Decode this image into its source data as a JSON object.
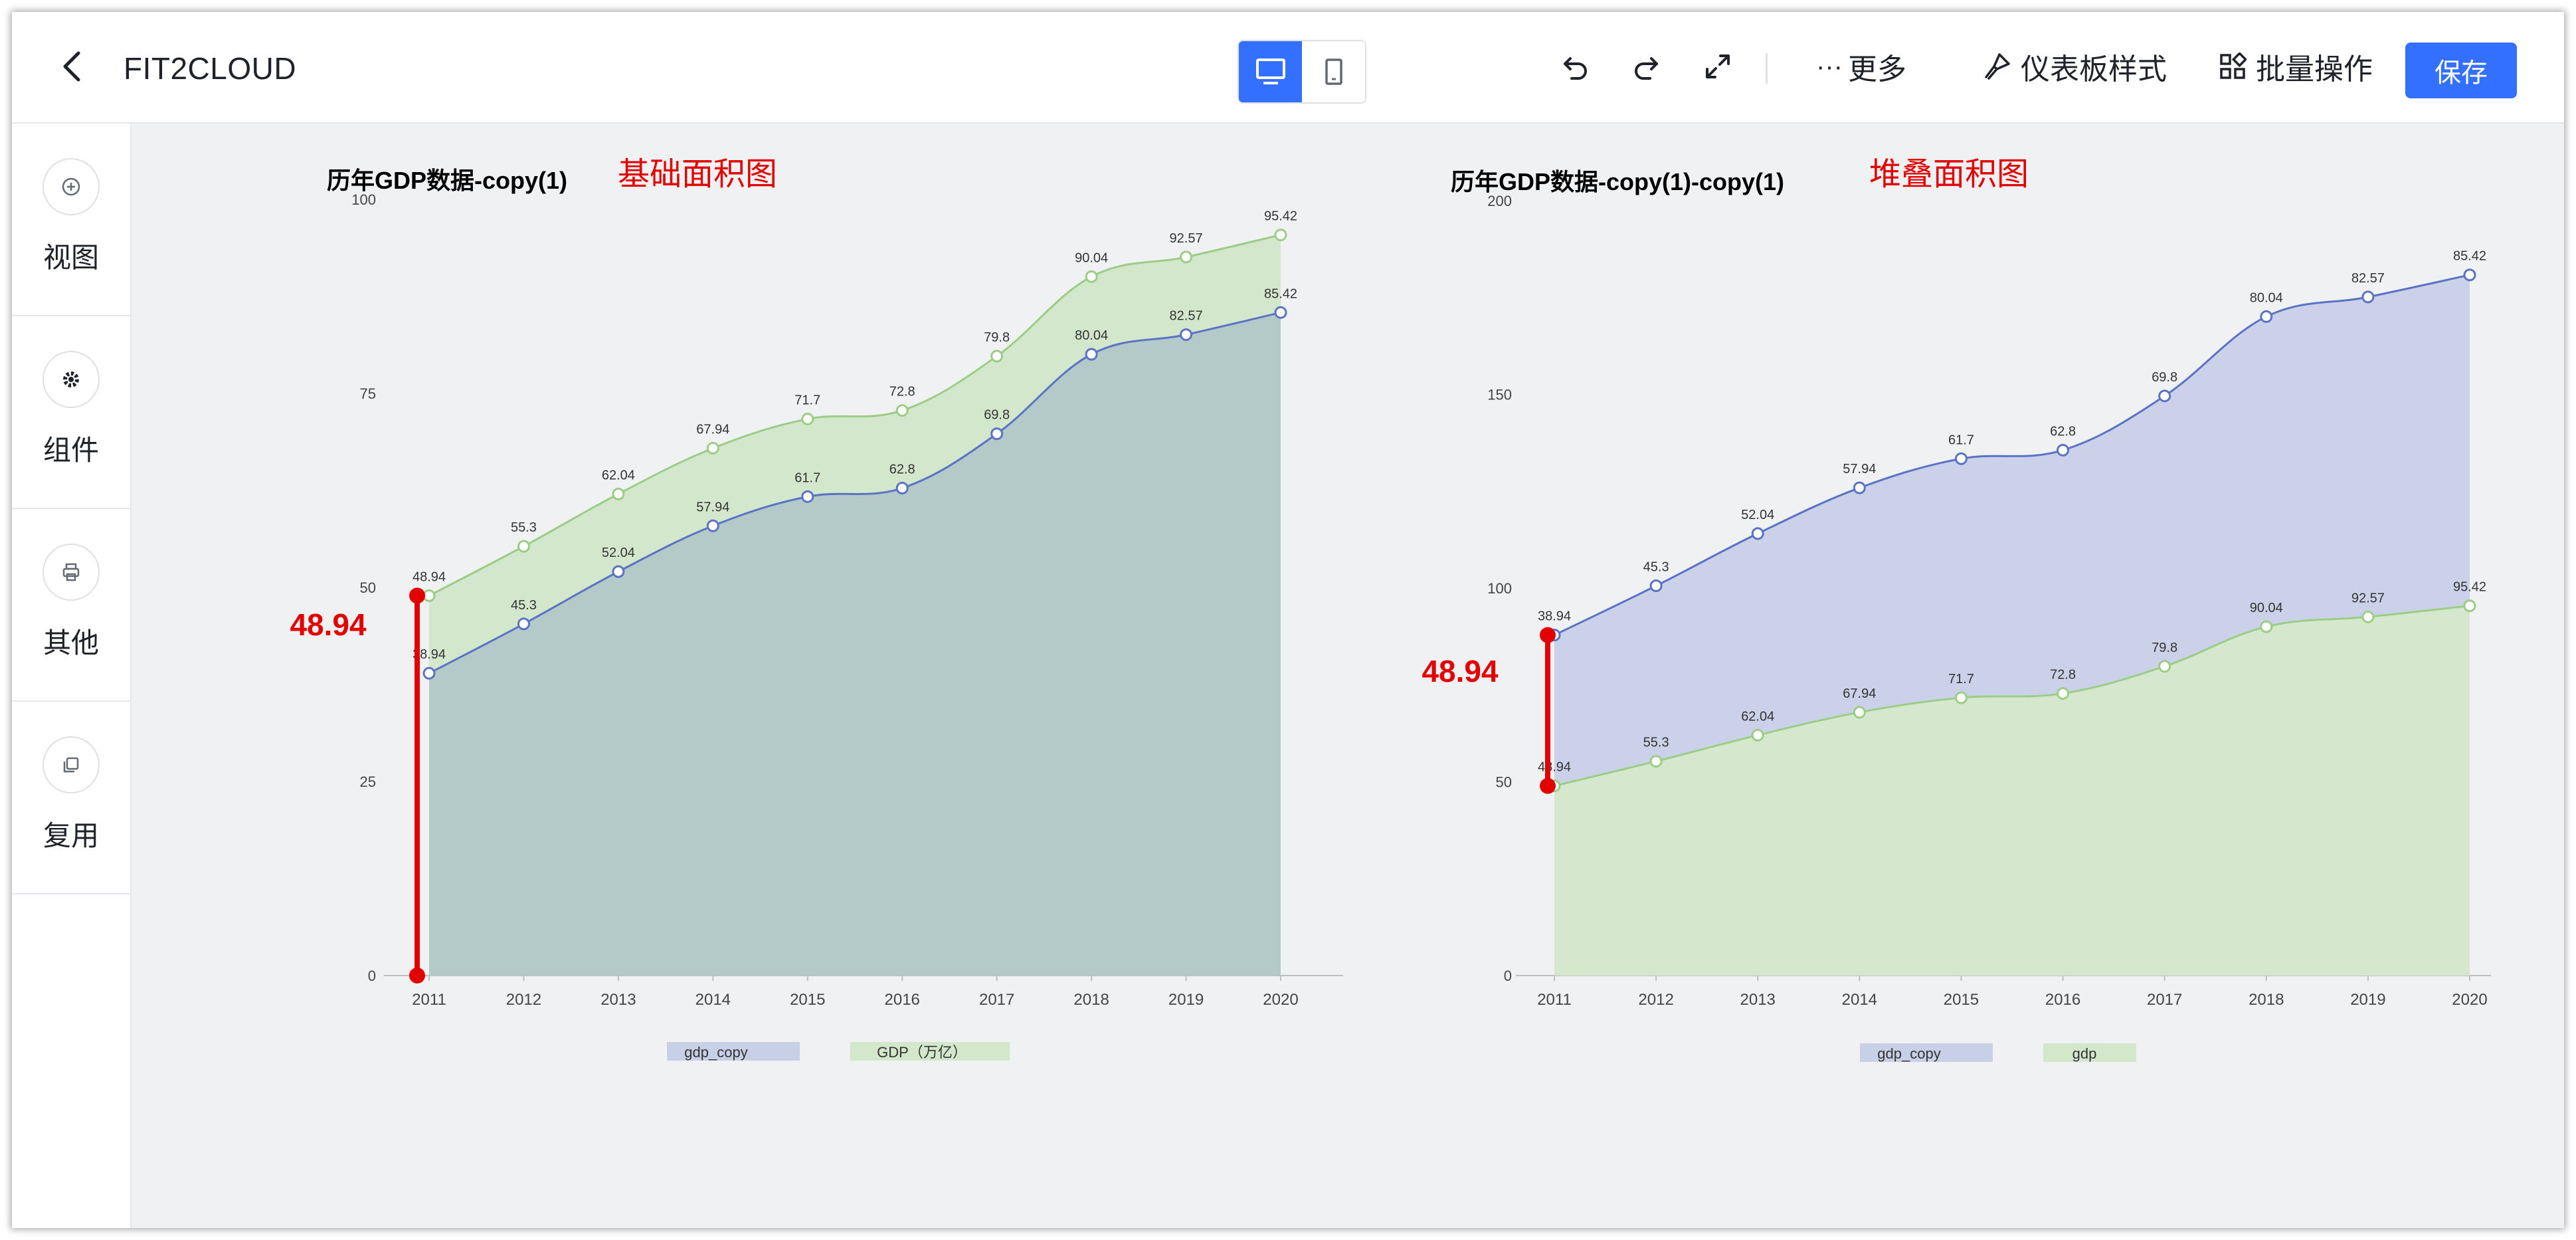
{
  "app": {
    "title": "FIT2CLOUD"
  },
  "toolbar": {
    "more": "更多",
    "dashboard_style": "仪表板样式",
    "batch": "批量操作",
    "save": "保存"
  },
  "sidebar": {
    "items": [
      {
        "label": "视图",
        "icon": "plus-circle-icon"
      },
      {
        "label": "组件",
        "icon": "gear-icon"
      },
      {
        "label": "其他",
        "icon": "printer-icon"
      },
      {
        "label": "复用",
        "icon": "copy-icon"
      }
    ]
  },
  "colors": {
    "accent": "#3370ff",
    "series_blue": "#5b73c4",
    "series_green": "#9ccd86",
    "annotation": "#e30000"
  },
  "chart_data": [
    {
      "type": "area",
      "title": "历年GDP数据-copy(1)",
      "annotation_title": "基础面积图",
      "annotation_value": "48.94",
      "x": [
        "2011",
        "2012",
        "2013",
        "2014",
        "2015",
        "2016",
        "2017",
        "2018",
        "2019",
        "2020"
      ],
      "ylim": [
        0,
        100
      ],
      "yticks": [
        "0",
        "25",
        "50",
        "75",
        "100"
      ],
      "series": [
        {
          "name": "gdp_copy",
          "values": [
            38.94,
            45.3,
            52.04,
            57.94,
            61.7,
            62.8,
            69.8,
            80.04,
            82.57,
            85.42
          ],
          "labels": [
            "38.94",
            "45.3",
            "52.04",
            "57.94",
            "61.7",
            "62.8",
            "69.8",
            "80.04",
            "82.57",
            "85.42"
          ]
        },
        {
          "name": "GDP（万亿）",
          "values": [
            48.94,
            55.3,
            62.04,
            67.94,
            71.7,
            72.8,
            79.8,
            90.04,
            92.57,
            95.42
          ],
          "labels": [
            "48.94",
            "55.3",
            "62.04",
            "67.94",
            "71.7",
            "72.8",
            "79.8",
            "90.04",
            "92.57",
            "95.42"
          ]
        }
      ],
      "stacked": false,
      "legend": "bottom-center"
    },
    {
      "type": "area",
      "title": "历年GDP数据-copy(1)-copy(1)",
      "annotation_title": "堆叠面积图",
      "annotation_value": "48.94",
      "x": [
        "2011",
        "2012",
        "2013",
        "2014",
        "2015",
        "2016",
        "2017",
        "2018",
        "2019",
        "2020"
      ],
      "ylim": [
        0,
        200
      ],
      "yticks": [
        "0",
        "50",
        "100",
        "150",
        "200"
      ],
      "series": [
        {
          "name": "gdp_copy",
          "values": [
            38.94,
            45.3,
            52.04,
            57.94,
            61.7,
            62.8,
            69.8,
            80.04,
            82.57,
            85.42
          ],
          "labels": [
            "38.94",
            "45.3",
            "52.04",
            "57.94",
            "61.7",
            "62.8",
            "69.8",
            "80.04",
            "82.57",
            "85.42"
          ]
        },
        {
          "name": "gdp",
          "values": [
            48.94,
            55.3,
            62.04,
            67.94,
            71.7,
            72.8,
            79.8,
            90.04,
            92.57,
            95.42
          ],
          "labels": [
            "48.94",
            "55.3",
            "62.04",
            "67.94",
            "71.7",
            "72.8",
            "79.8",
            "90.04",
            "92.57",
            "95.42"
          ]
        }
      ],
      "stacked": true,
      "legend": "bottom-center"
    }
  ]
}
